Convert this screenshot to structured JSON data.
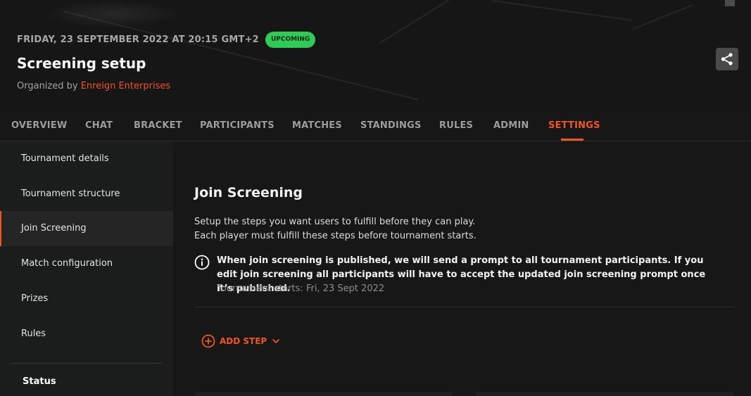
{
  "event": {
    "datetime": "FRIDAY, 23 SEPTEMBER 2022 AT 20:15 GMT+2",
    "status_badge": "UPCOMING",
    "title": "Screening setup",
    "organized_prefix": "Organized by",
    "organizer": "Enreign Enterprises",
    "share_icon": "share-icon"
  },
  "tabs": [
    {
      "label": "OVERVIEW",
      "active": false
    },
    {
      "label": "CHAT",
      "active": false
    },
    {
      "label": "BRACKET",
      "active": false
    },
    {
      "label": "PARTICIPANTS",
      "active": false
    },
    {
      "label": "MATCHES",
      "active": false
    },
    {
      "label": "STANDINGS",
      "active": false
    },
    {
      "label": "RULES",
      "active": false
    },
    {
      "label": "ADMIN",
      "active": false
    },
    {
      "label": "SETTINGS",
      "active": true
    }
  ],
  "sidebar": {
    "items": [
      {
        "label": "Tournament details",
        "active": false
      },
      {
        "label": "Tournament structure",
        "active": false
      },
      {
        "label": "Join Screening",
        "active": true
      },
      {
        "label": "Match configuration",
        "active": false
      },
      {
        "label": "Prizes",
        "active": false
      },
      {
        "label": "Rules",
        "active": false
      }
    ],
    "section_heading": "Status"
  },
  "main": {
    "title": "Join Screening",
    "description_line1": "Setup the steps you want users to fulfill before they can play.",
    "description_line2": "Each player must fulfill these steps before tournament starts.",
    "info_icon": "info-icon",
    "info_text": "When join screening is published, we will send a prompt to all tournament participants. If you edit join screening all participants will have to accept the updated join screening prompt once it’s published.",
    "info_subtext": "Tournament starts: Fri, 23 Sept 2022",
    "add_step_label": "ADD STEP"
  },
  "colors": {
    "accent": "#f0561d",
    "badge_green": "#2ecc55",
    "background": "#171717",
    "sidebar_bg": "#1b1c1c"
  }
}
